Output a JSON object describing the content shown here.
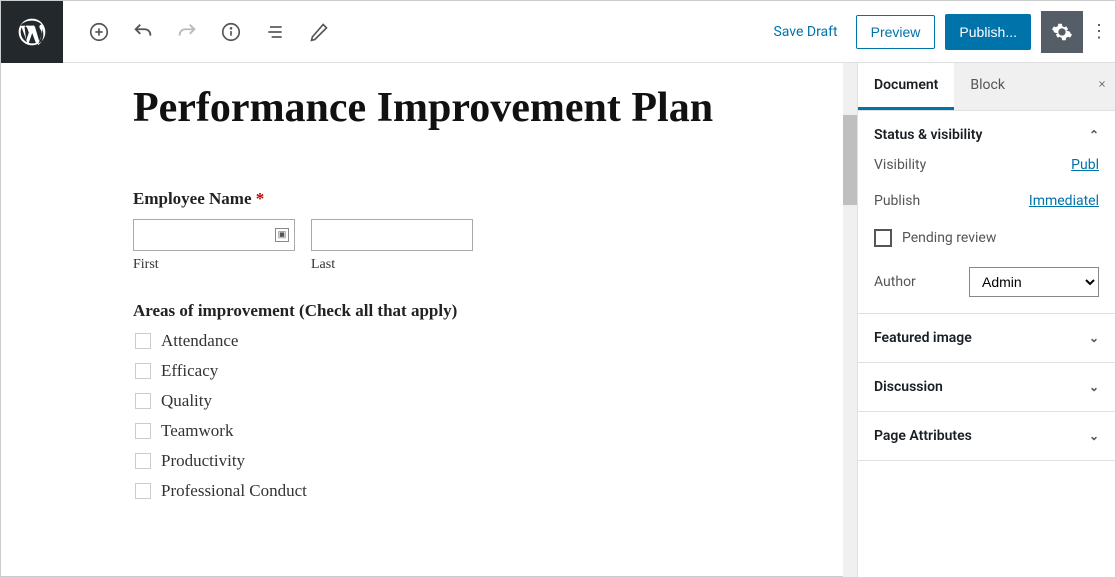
{
  "topbar": {
    "save_draft": "Save Draft",
    "preview": "Preview",
    "publish": "Publish..."
  },
  "page": {
    "title": "Performance Improvement Plan"
  },
  "form": {
    "employee_name_label": "Employee Name",
    "first_sublabel": "First",
    "last_sublabel": "Last",
    "areas_label": "Areas of improvement (Check all that apply)",
    "areas": [
      "Attendance",
      "Efficacy",
      "Quality",
      "Teamwork",
      "Productivity",
      "Professional Conduct"
    ]
  },
  "sidebar": {
    "tabs": {
      "document": "Document",
      "block": "Block"
    },
    "status_title": "Status & visibility",
    "visibility_label": "Visibility",
    "visibility_value": "Publ",
    "publish_label": "Publish",
    "publish_value": "Immediatel",
    "pending_label": "Pending review",
    "author_label": "Author",
    "author_value": "Admin",
    "featured_image": "Featured image",
    "discussion": "Discussion",
    "page_attributes": "Page Attributes"
  }
}
